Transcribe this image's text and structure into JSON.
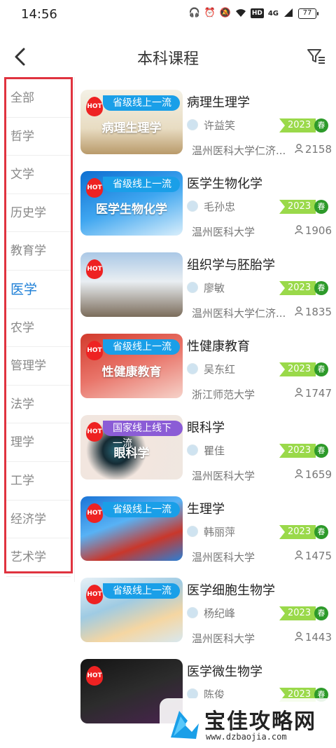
{
  "status": {
    "time": "14:56",
    "network": "4G",
    "battery": "77"
  },
  "header": {
    "title": "本科课程"
  },
  "sidebar": {
    "items": [
      {
        "label": "全部"
      },
      {
        "label": "哲学"
      },
      {
        "label": "文学"
      },
      {
        "label": "历史学"
      },
      {
        "label": "教育学"
      },
      {
        "label": "医学",
        "active": true
      },
      {
        "label": "农学"
      },
      {
        "label": "管理学"
      },
      {
        "label": "法学"
      },
      {
        "label": "理学"
      },
      {
        "label": "工学"
      },
      {
        "label": "经济学"
      },
      {
        "label": "艺术学"
      }
    ]
  },
  "courses": [
    {
      "title": "病理生理学",
      "tag": "省级线上一流",
      "tag_color": "blue",
      "thumb_text": "病理生理学",
      "teacher": "许益笑",
      "year": "2023",
      "season": "春",
      "school": "温州医科大学仁济...",
      "count": "2158",
      "hot": "HOT"
    },
    {
      "title": "医学生物化学",
      "tag": "省级线上一流",
      "tag_color": "blue",
      "thumb_text": "医学生物化学",
      "teacher": "毛孙忠",
      "year": "2023",
      "season": "春",
      "school": "温州医科大学",
      "count": "1906",
      "hot": "HOT"
    },
    {
      "title": "组织学与胚胎学",
      "tag": "",
      "tag_color": "",
      "thumb_text": "",
      "teacher": "廖敏",
      "year": "2023",
      "season": "春",
      "school": "温州医科大学仁济...",
      "count": "1835",
      "hot": "HOT"
    },
    {
      "title": "性健康教育",
      "tag": "省级线上一流",
      "tag_color": "blue",
      "thumb_text": "性健康教育",
      "teacher": "吴东红",
      "year": "2023",
      "season": "春",
      "school": "浙江师范大学",
      "count": "1747",
      "hot": "HOT"
    },
    {
      "title": "眼科学",
      "tag": "国家线上线下一流",
      "tag_color": "purple",
      "thumb_text": "眼科学",
      "teacher": "瞿佳",
      "year": "2023",
      "season": "春",
      "school": "温州医科大学",
      "count": "1659",
      "hot": "HOT"
    },
    {
      "title": "生理学",
      "tag": "省级线上一流",
      "tag_color": "blue",
      "thumb_text": "",
      "teacher": "韩丽萍",
      "year": "2023",
      "season": "春",
      "school": "温州医科大学",
      "count": "1475",
      "hot": "HOT"
    },
    {
      "title": "医学细胞生物学",
      "tag": "省级线上一流",
      "tag_color": "blue",
      "thumb_text": "",
      "teacher": "杨纪峰",
      "year": "2023",
      "season": "春",
      "school": "温州医科大学",
      "count": "1443",
      "hot": "HOT"
    },
    {
      "title": "医学微生物学",
      "tag": "",
      "tag_color": "",
      "thumb_text": "",
      "teacher": "陈俊",
      "year": "2023",
      "season": "春",
      "school": "",
      "count": "",
      "hot": "HOT"
    }
  ],
  "watermark": {
    "title": "宝佳攻略网",
    "url": "www.dzbaojia.com"
  },
  "colors": {
    "accent": "#1c7ed6",
    "highlight_border": "#e0333f",
    "year_flag": "#9ad94a",
    "season_dot": "#2d9a2a",
    "hot": "#e22222"
  }
}
